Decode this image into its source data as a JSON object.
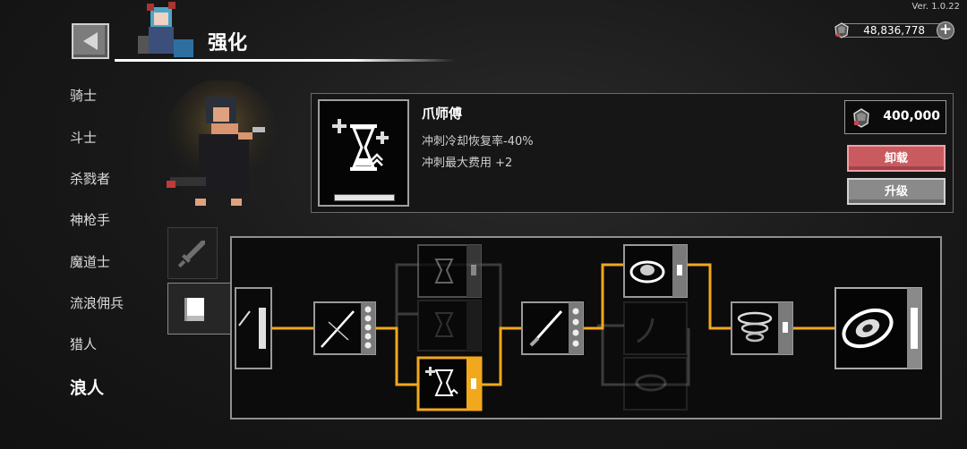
{
  "version": "Ver. 1.0.22",
  "header": {
    "title": "强化"
  },
  "currency": {
    "amount": "48,836,778",
    "icon": "gem-icon",
    "add_icon": "plus-icon"
  },
  "sidebar": {
    "classes": [
      {
        "label": "骑士",
        "active": false
      },
      {
        "label": "斗士",
        "active": false
      },
      {
        "label": "杀戮者",
        "active": false
      },
      {
        "label": "神枪手",
        "active": false
      },
      {
        "label": "魔道士",
        "active": false
      },
      {
        "label": "流浪佣兵",
        "active": false
      },
      {
        "label": "猎人",
        "active": false
      },
      {
        "label": "浪人",
        "active": true
      }
    ]
  },
  "skill": {
    "name": "爪师傅",
    "effects": [
      "冲刺冷却恢复率-40%",
      "冲刺最大费用 +2"
    ],
    "price": "400,000",
    "icon": "hourglass-icon"
  },
  "buttons": {
    "unequip": "卸载",
    "upgrade": "升级"
  },
  "tabs": [
    {
      "name": "weapon",
      "icon": "sword-icon",
      "active": false
    },
    {
      "name": "skills",
      "icon": "book-icon",
      "active": true
    }
  ],
  "colors": {
    "accent_path": "#f2a81d",
    "unequip": "#c95a5f",
    "upgrade": "#8a8a8a",
    "background": "#141414"
  }
}
